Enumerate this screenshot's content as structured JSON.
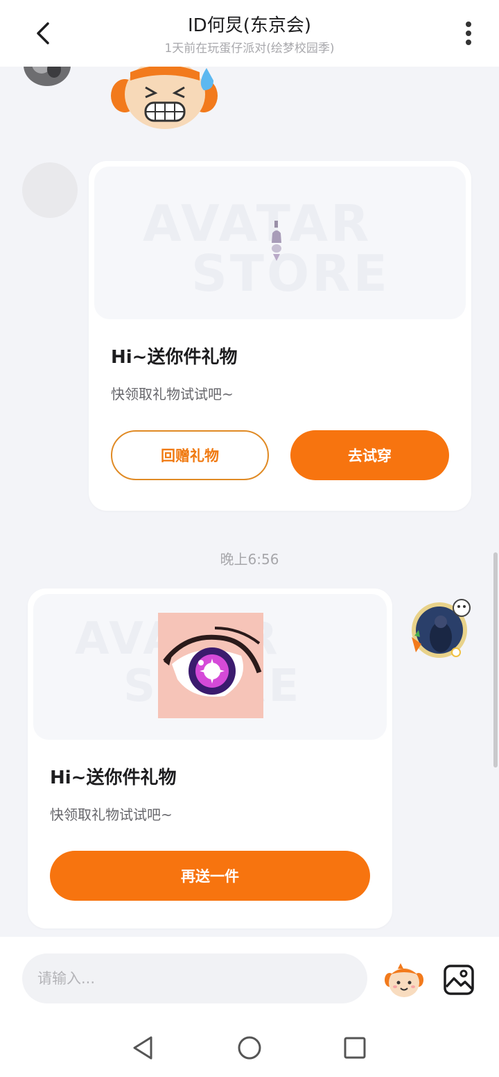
{
  "header": {
    "title": "ID何炅(东京会)",
    "subtitle": "1天前在玩蛋仔派对(绘梦校园季)"
  },
  "messages": {
    "gift_received": {
      "title": "Hi~送你件礼物",
      "description": "快领取礼物试试吧~",
      "return_gift_label": "回赠礼物",
      "try_on_label": "去试穿"
    },
    "timestamp": "晚上6:56",
    "gift_sent": {
      "title": "Hi~送你件礼物",
      "description": "快领取礼物试试吧~",
      "send_again_label": "再送一件"
    }
  },
  "input": {
    "placeholder": "请输入..."
  },
  "colors": {
    "accent": "#f7740f",
    "outline": "#e08a24",
    "background": "#f3f4f8"
  },
  "icons": [
    "back-arrow-icon",
    "more-vertical-icon",
    "emoji-sticker-icon",
    "image-icon",
    "nav-back-icon",
    "nav-home-icon",
    "nav-recents-icon"
  ]
}
